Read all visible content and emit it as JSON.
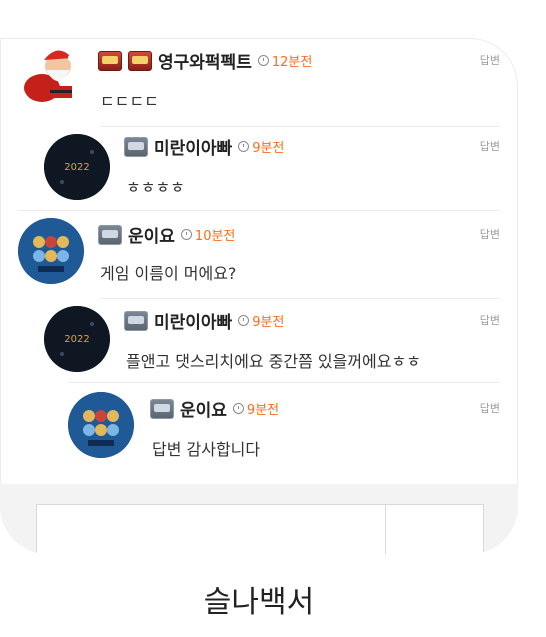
{
  "comments": [
    {
      "nick": "영구와퍽펙트",
      "time": "12분전",
      "reply": "답변",
      "text": "ㄷㄷㄷㄷ"
    },
    {
      "nick": "미란이아빠",
      "time": "9분전",
      "reply": "답변",
      "text": "ㅎㅎㅎㅎ"
    },
    {
      "nick": "운이요",
      "time": "10분전",
      "reply": "답변",
      "text": "게임 이름이 머에요?"
    },
    {
      "nick": "미란이아빠",
      "time": "9분전",
      "reply": "답변",
      "text": "플앤고 댓스리치에요 중간쯤 있을꺼에요ㅎㅎ"
    },
    {
      "nick": "운이요",
      "time": "9분전",
      "reply": "답변",
      "text": "답변 감사합니다"
    }
  ],
  "footer": {
    "label": "슬나백서"
  },
  "colors": {
    "time": "#ff6b1a",
    "nick": "#222222",
    "reply": "#9b9b9b"
  }
}
